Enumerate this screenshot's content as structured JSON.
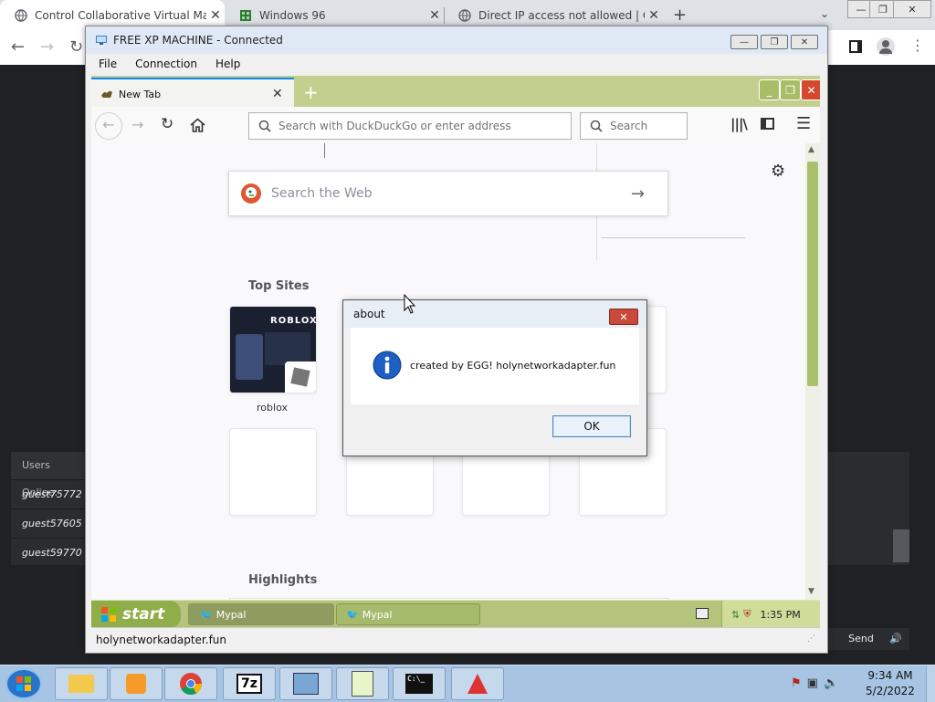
{
  "host_browser": {
    "tabs": [
      {
        "title": "Control Collaborative Virtual Ma",
        "active": true
      },
      {
        "title": "Windows 96",
        "active": false
      },
      {
        "title": "Direct IP access not allowed | Clo",
        "active": false
      }
    ],
    "tab_close": "✕",
    "new_tab": "+"
  },
  "users_panel": {
    "header": "Users Online:",
    "users": [
      "guest75772",
      "guest57605",
      "guest59770"
    ]
  },
  "chat": {
    "send_label": "Send"
  },
  "vm_window": {
    "title": "FREE XP MACHINE - Connected",
    "menu": [
      "File",
      "Connection",
      "Help"
    ]
  },
  "firefox": {
    "tab_title": "New Tab",
    "address_placeholder": "Search with DuckDuckGo or enter address",
    "search_placeholder": "Search",
    "ddg_placeholder": "Search the Web",
    "top_sites_label": "Top Sites",
    "highlights_label": "Highlights",
    "sites": [
      {
        "label": "roblox"
      }
    ],
    "status_url": "holynetworkadapter.fun"
  },
  "xp_taskbar": {
    "start_label": "start",
    "buttons": [
      "Mypal",
      "Mypal"
    ],
    "clock": "1:35 PM"
  },
  "about_dialog": {
    "title": "about",
    "message": "created by EGG! holynetworkadapter.fun",
    "ok_label": "OK"
  },
  "win7_taskbar": {
    "apps": [
      "explorer",
      "media-player",
      "chrome",
      "7zip",
      "network",
      "notepad",
      "cmd",
      "java"
    ],
    "sevenzip_label": "7z",
    "cmd_label": "C:\\_",
    "time": "9:34 AM",
    "date": "5/2/2022"
  },
  "colors": {
    "xp_olive": "#b4c47d",
    "firefox_blue": "#0a84ff",
    "ddg_orange": "#de5833"
  }
}
